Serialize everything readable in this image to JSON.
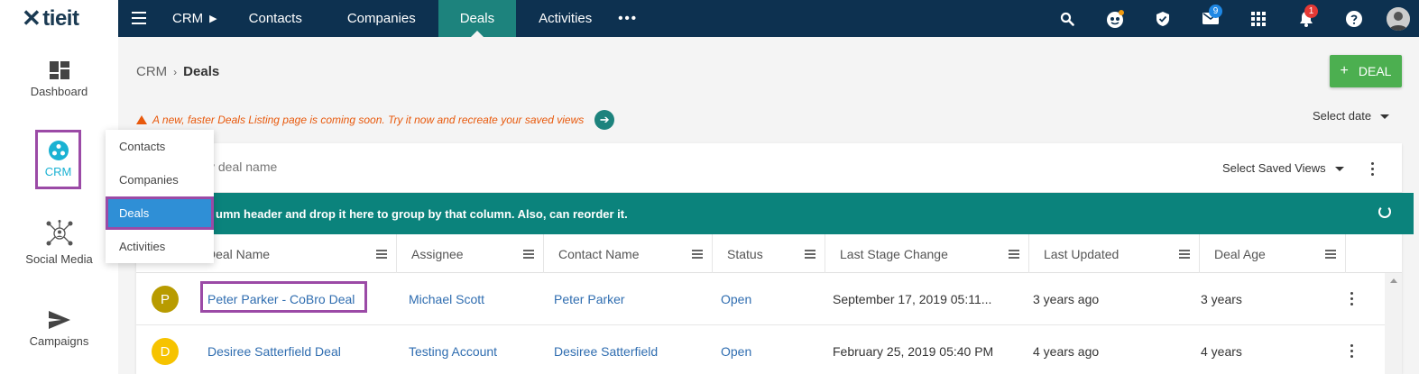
{
  "brand": {
    "logo_text": "tieit"
  },
  "topnav": {
    "crm_label": "CRM",
    "items": [
      "Contacts",
      "Companies",
      "Deals",
      "Activities"
    ],
    "more_label": "•••"
  },
  "notifications": {
    "mail_count": "9",
    "alerts_count": "1"
  },
  "sidebar": {
    "items": [
      {
        "label": "Dashboard",
        "icon": "dashboard-icon"
      },
      {
        "label": "CRM",
        "icon": "crm-icon"
      },
      {
        "label": "Social Media",
        "icon": "social-media-icon"
      },
      {
        "label": "Campaigns",
        "icon": "campaigns-icon"
      }
    ]
  },
  "flyout": {
    "items": [
      "Contacts",
      "Companies",
      "Deals",
      "Activities"
    ]
  },
  "breadcrumb": {
    "root": "CRM",
    "current": "Deals"
  },
  "deal_button": {
    "label": "DEAL"
  },
  "notice": {
    "text": "A new, faster Deals Listing page is coming soon. Try it now and recreate your saved views"
  },
  "select_date": {
    "label": "Select date"
  },
  "search": {
    "placeholder": "y deal name"
  },
  "saved_views": {
    "label": "Select Saved Views"
  },
  "group_bar": {
    "text": "umn header and drop it here to group by that column. Also, can reorder it."
  },
  "table": {
    "columns": [
      "Deal Name",
      "Assignee",
      "Contact Name",
      "Status",
      "Last Stage Change",
      "Last Updated",
      "Deal Age"
    ],
    "rows": [
      {
        "initial": "P",
        "avatar_color": "#b89b00",
        "deal": "Peter Parker - CoBro Deal",
        "assignee": "Michael Scott",
        "contact": "Peter Parker",
        "status": "Open",
        "last_stage": "September 17, 2019 05:11...",
        "updated": "3 years ago",
        "age": "3 years"
      },
      {
        "initial": "D",
        "avatar_color": "#f6c300",
        "deal": "Desiree Satterfield Deal",
        "assignee": "Testing Account",
        "contact": "Desiree Satterfield",
        "status": "Open",
        "last_stage": "February 25, 2019 05:40 PM",
        "updated": "4 years ago",
        "age": "4 years"
      }
    ]
  },
  "colors": {
    "topbar": "#0d3150",
    "active_tab": "#1d837d",
    "deal_button": "#4caf50",
    "highlight": "#9b4aa6",
    "link": "#2f6db0",
    "notice": "#e8590c"
  }
}
